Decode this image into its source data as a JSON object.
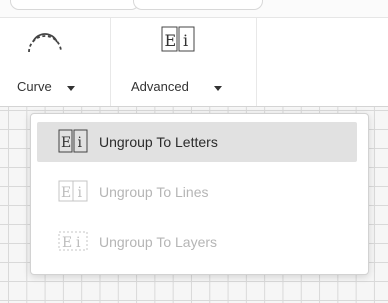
{
  "toolbar": {
    "curve": {
      "label": "Curve",
      "icon": "curve-icon"
    },
    "advanced": {
      "label": "Advanced",
      "icon": "ungroup-letters-icon"
    }
  },
  "dropdown": {
    "items": [
      {
        "label": "Ungroup To Letters",
        "icon": "ungroup-letters-icon",
        "state": "highlighted"
      },
      {
        "label": "Ungroup To Lines",
        "icon": "ungroup-lines-icon",
        "state": "disabled"
      },
      {
        "label": "Ungroup To Layers",
        "icon": "ungroup-layers-icon",
        "state": "disabled"
      }
    ]
  },
  "colors": {
    "menu_highlight": "#e1e1e1",
    "disabled_text": "#b5b5b5",
    "canvas_grid": "#d9d9d9"
  }
}
